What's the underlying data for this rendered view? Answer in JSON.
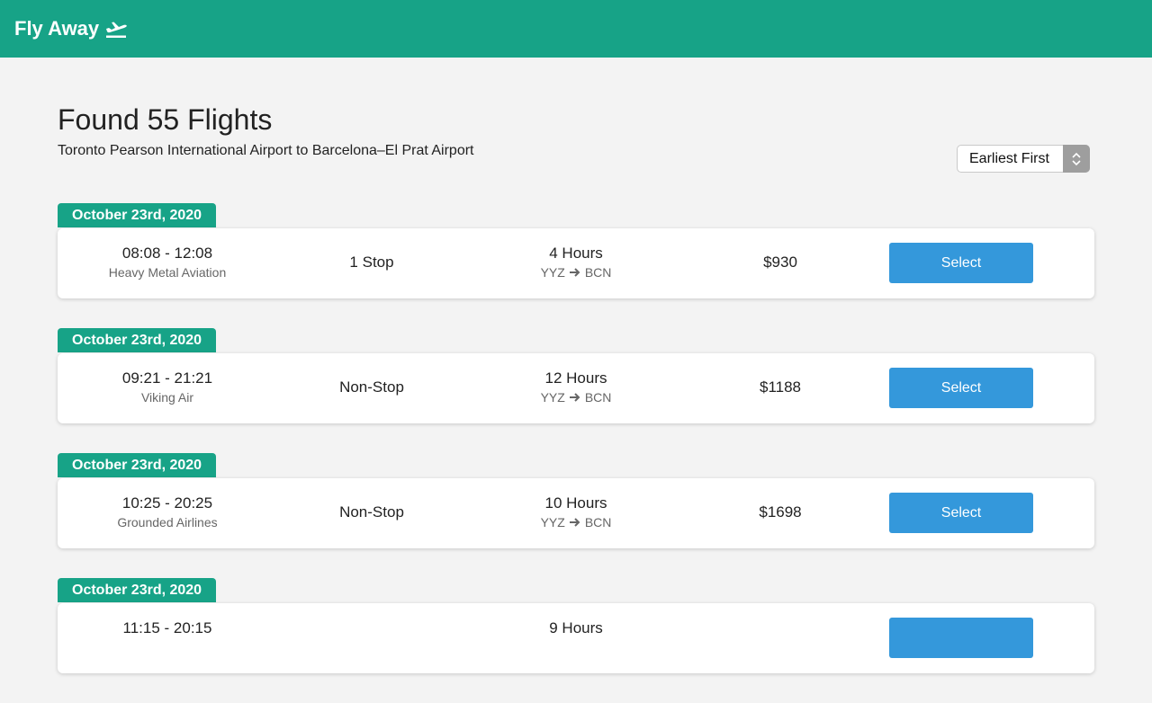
{
  "header": {
    "brand": "Fly Away",
    "brand_icon": "plane-departure-icon",
    "color": "#17a387"
  },
  "main": {
    "title": "Found 55 Flights",
    "subtitle": "Toronto Pearson International Airport to Barcelona–El Prat Airport",
    "sort": {
      "selected": "Earliest First"
    }
  },
  "flights": [
    {
      "date": "October 23rd, 2020",
      "time": "08:08 - 12:08",
      "airline": "Heavy Metal Aviation",
      "stops": "1 Stop",
      "duration": "4 Hours",
      "from": "YYZ",
      "to": "BCN",
      "price": "$930",
      "select_label": "Select"
    },
    {
      "date": "October 23rd, 2020",
      "time": "09:21 - 21:21",
      "airline": "Viking Air",
      "stops": "Non-Stop",
      "duration": "12 Hours",
      "from": "YYZ",
      "to": "BCN",
      "price": "$1188",
      "select_label": "Select"
    },
    {
      "date": "October 23rd, 2020",
      "time": "10:25 - 20:25",
      "airline": "Grounded Airlines",
      "stops": "Non-Stop",
      "duration": "10 Hours",
      "from": "YYZ",
      "to": "BCN",
      "price": "$1698",
      "select_label": "Select"
    },
    {
      "date": "October 23rd, 2020",
      "time": "11:15 - 20:15",
      "airline": "",
      "stops": "",
      "duration": "9 Hours",
      "from": "",
      "to": "",
      "price": "",
      "select_label": ""
    }
  ],
  "colors": {
    "accent": "#17a387",
    "button": "#3498db",
    "background": "#f3f3f3"
  }
}
